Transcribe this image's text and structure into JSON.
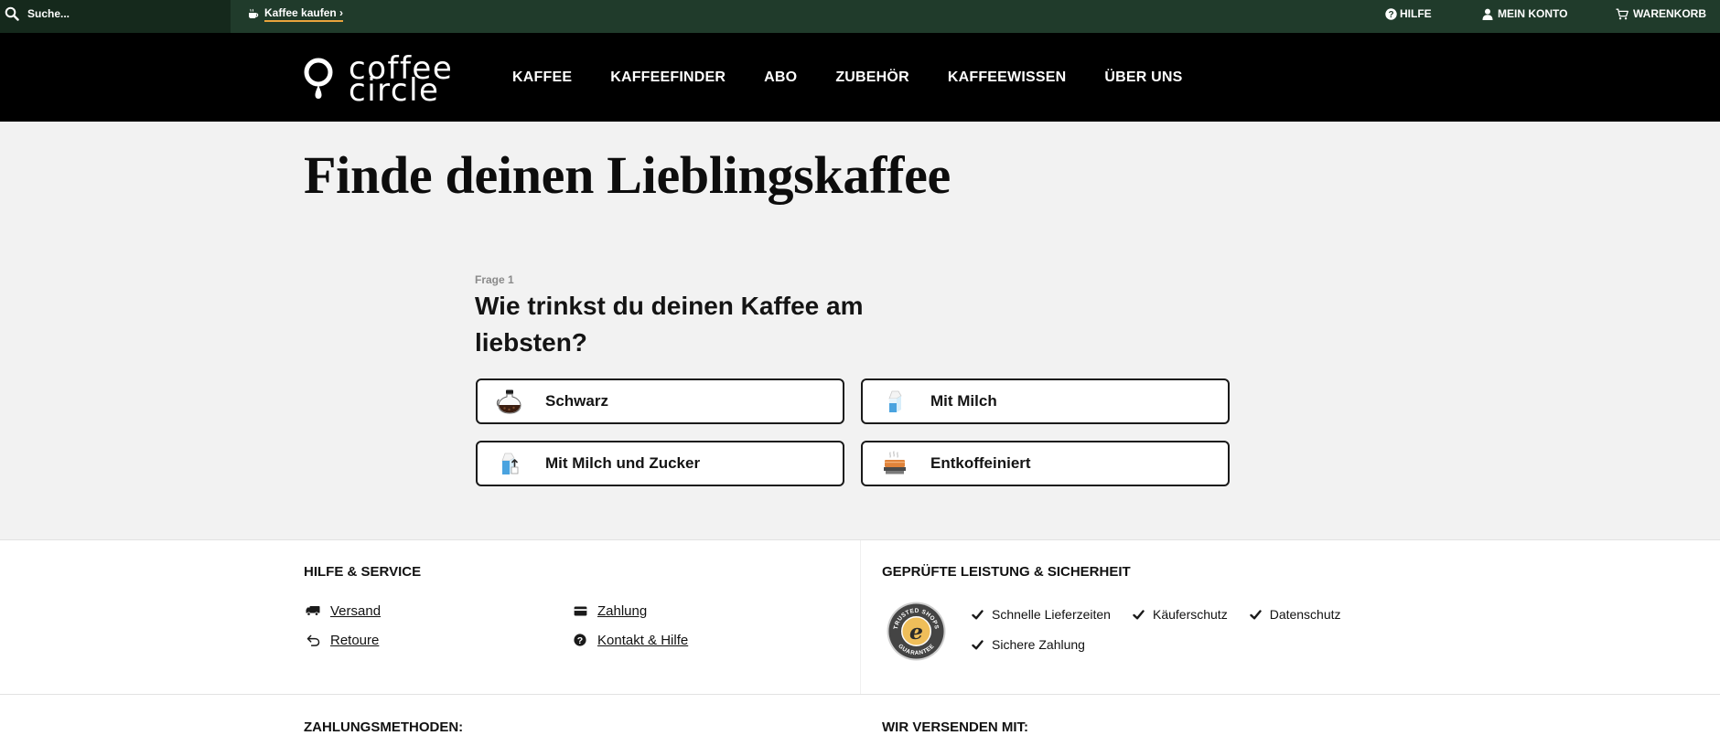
{
  "topbar": {
    "search": {
      "placeholder": "Suche...",
      "icon": "search-icon"
    },
    "shop_link": {
      "label": "Kaffee kaufen ›",
      "icon": "coffee-cup-icon"
    },
    "help": {
      "label": "HILFE",
      "icon": "help-circle-icon"
    },
    "account": {
      "label": "MEIN KONTO",
      "icon": "user-icon"
    },
    "cart": {
      "label": "WARENKORB",
      "icon": "cart-icon"
    }
  },
  "logo": {
    "line1": "coffee",
    "line2": "circle",
    "icon": "coffee-circle-logo-mark"
  },
  "nav": [
    {
      "label": "KAFFEE"
    },
    {
      "label": "KAFFEEFINDER"
    },
    {
      "label": "ABO"
    },
    {
      "label": "ZUBEHÖR"
    },
    {
      "label": "KAFFEEWISSEN"
    },
    {
      "label": "ÜBER UNS"
    }
  ],
  "page_title": "Finde deinen Lieblingskaffee",
  "quiz": {
    "step_label": "Frage 1",
    "question": "Wie trinkst du deinen Kaffee am liebsten?",
    "options": [
      {
        "label": "Schwarz",
        "icon": "coffee-pot-icon"
      },
      {
        "label": "Mit Milch",
        "icon": "milk-carton-icon"
      },
      {
        "label": "Mit Milch und Zucker",
        "icon": "milk-sugar-icon"
      },
      {
        "label": "Entkoffeiniert",
        "icon": "decaf-coffee-icon"
      }
    ]
  },
  "service": {
    "help": {
      "title": "HILFE & SERVICE",
      "links": [
        {
          "label": "Versand",
          "icon": "truck-icon"
        },
        {
          "label": "Zahlung",
          "icon": "credit-card-icon"
        },
        {
          "label": "Retoure",
          "icon": "return-arrow-icon"
        },
        {
          "label": "Kontakt & Hilfe",
          "icon": "help-circle-icon"
        }
      ]
    },
    "trust": {
      "title": "GEPRÜFTE LEISTUNG & SICHERHEIT",
      "badge": {
        "top_text": "TRUSTED SHOPS",
        "bottom_text": "GUARANTEE",
        "icon": "trusted-shops-badge"
      },
      "features": [
        "Schnelle Lieferzeiten",
        "Käuferschutz",
        "Datenschutz",
        "Sichere Zahlung"
      ]
    }
  },
  "footer": {
    "payment_title": "ZAHLUNGSMETHODEN:",
    "shipping_title": "WIR VERSENDEN MIT:"
  },
  "colors": {
    "topbar_bg": "#203b2b",
    "search_bg": "#15291c",
    "nav_bg": "#000000",
    "accent": "#e8a33d",
    "page_bg": "#f2f2f2"
  }
}
